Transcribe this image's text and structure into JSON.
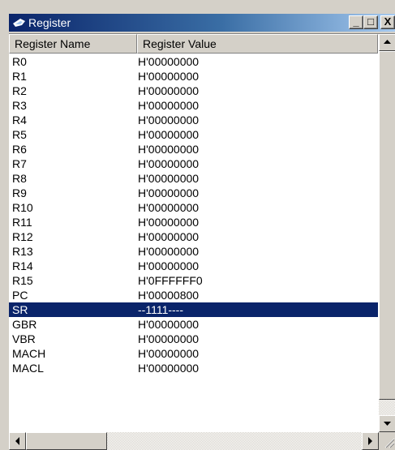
{
  "window": {
    "title": "Register",
    "minimize_label": "_",
    "maximize_label": "□",
    "close_label": "X"
  },
  "columns": [
    "Register Name",
    "Register Value"
  ],
  "rows": [
    {
      "name": "R0",
      "value": "H'00000000"
    },
    {
      "name": "R1",
      "value": "H'00000000"
    },
    {
      "name": "R2",
      "value": "H'00000000"
    },
    {
      "name": "R3",
      "value": "H'00000000"
    },
    {
      "name": "R4",
      "value": "H'00000000"
    },
    {
      "name": "R5",
      "value": "H'00000000"
    },
    {
      "name": "R6",
      "value": "H'00000000"
    },
    {
      "name": "R7",
      "value": "H'00000000"
    },
    {
      "name": "R8",
      "value": "H'00000000"
    },
    {
      "name": "R9",
      "value": "H'00000000"
    },
    {
      "name": "R10",
      "value": "H'00000000"
    },
    {
      "name": "R11",
      "value": "H'00000000"
    },
    {
      "name": "R12",
      "value": "H'00000000"
    },
    {
      "name": "R13",
      "value": "H'00000000"
    },
    {
      "name": "R14",
      "value": "H'00000000"
    },
    {
      "name": "R15",
      "value": "H'0FFFFFF0"
    },
    {
      "name": "PC",
      "value": "H'00000800"
    },
    {
      "name": "SR",
      "value": "--1111----",
      "selected": true
    },
    {
      "name": "GBR",
      "value": "H'00000000"
    },
    {
      "name": "VBR",
      "value": "H'00000000"
    },
    {
      "name": "MACH",
      "value": "H'00000000"
    },
    {
      "name": "MACL",
      "value": "H'00000000"
    }
  ],
  "colors": {
    "selection": "#0a246a",
    "title_gradient_start": "#0a246a",
    "title_gradient_end": "#a6caf0",
    "face": "#d4d0c8"
  }
}
